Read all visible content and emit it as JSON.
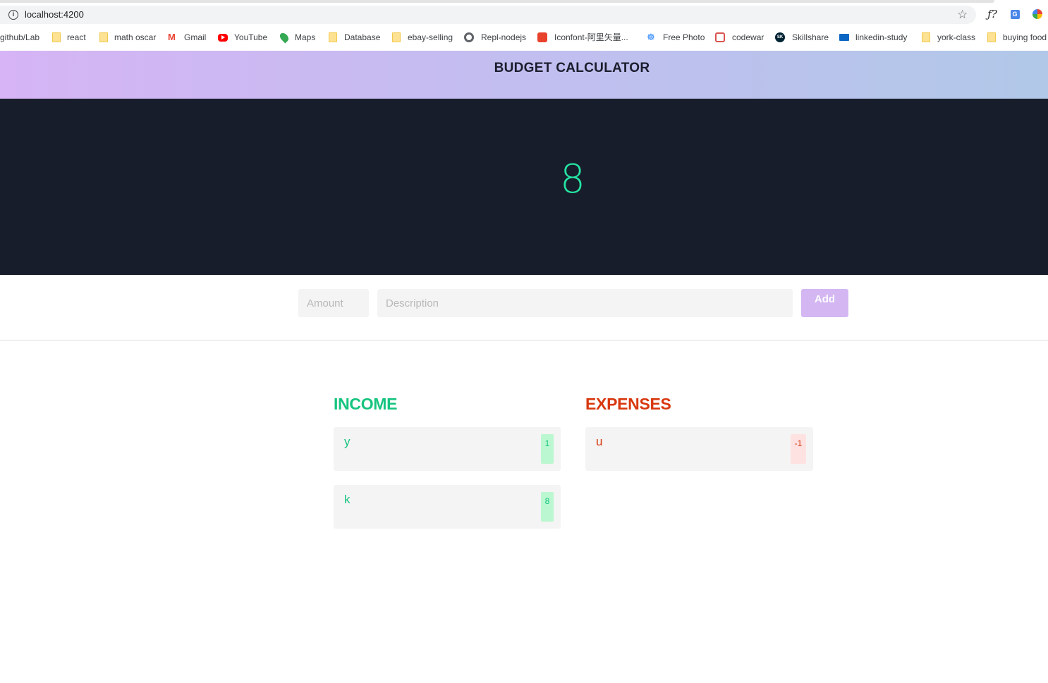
{
  "browser": {
    "url": "localhost:4200",
    "extensions": {
      "fx_label": "ƒ?",
      "translate_label": "G"
    }
  },
  "bookmarks": [
    {
      "label": "github/Lab",
      "icon": "none"
    },
    {
      "label": "react",
      "icon": "folder-icon"
    },
    {
      "label": "math oscar",
      "icon": "folder-icon"
    },
    {
      "label": "Gmail",
      "icon": "gmail-icon"
    },
    {
      "label": "YouTube",
      "icon": "youtube-icon"
    },
    {
      "label": "Maps",
      "icon": "maps-icon"
    },
    {
      "label": "Database",
      "icon": "folder-icon"
    },
    {
      "label": "ebay-selling",
      "icon": "folder-icon"
    },
    {
      "label": "Repl-nodejs",
      "icon": "repl-icon"
    },
    {
      "label": "Iconfont-阿里矢量...",
      "icon": "iconfont-icon"
    },
    {
      "label": "Free Photo",
      "icon": "free-photo-icon"
    },
    {
      "label": "codewar",
      "icon": "codewars-icon"
    },
    {
      "label": "Skillshare",
      "icon": "skillshare-icon"
    },
    {
      "label": "linkedin-study",
      "icon": "linkedin-learning-icon"
    },
    {
      "label": "york-class",
      "icon": "folder-icon"
    },
    {
      "label": "buying food",
      "icon": "folder-icon"
    }
  ],
  "app": {
    "title": "BUDGET CALCULATOR",
    "total": "8",
    "form": {
      "amount_placeholder": "Amount",
      "description_placeholder": "Description",
      "add_label": "Add"
    },
    "income": {
      "title": "INCOME",
      "items": [
        {
          "description": "y",
          "amount": "1"
        },
        {
          "description": "k",
          "amount": "8"
        }
      ]
    },
    "expenses": {
      "title": "EXPENSES",
      "items": [
        {
          "description": "u",
          "amount": "-1"
        }
      ]
    }
  },
  "colors": {
    "income": "#16c47f",
    "expense": "#d8380f",
    "total": "#24e3a2",
    "panel": "#181d2b",
    "button": "#d3b6f2"
  }
}
